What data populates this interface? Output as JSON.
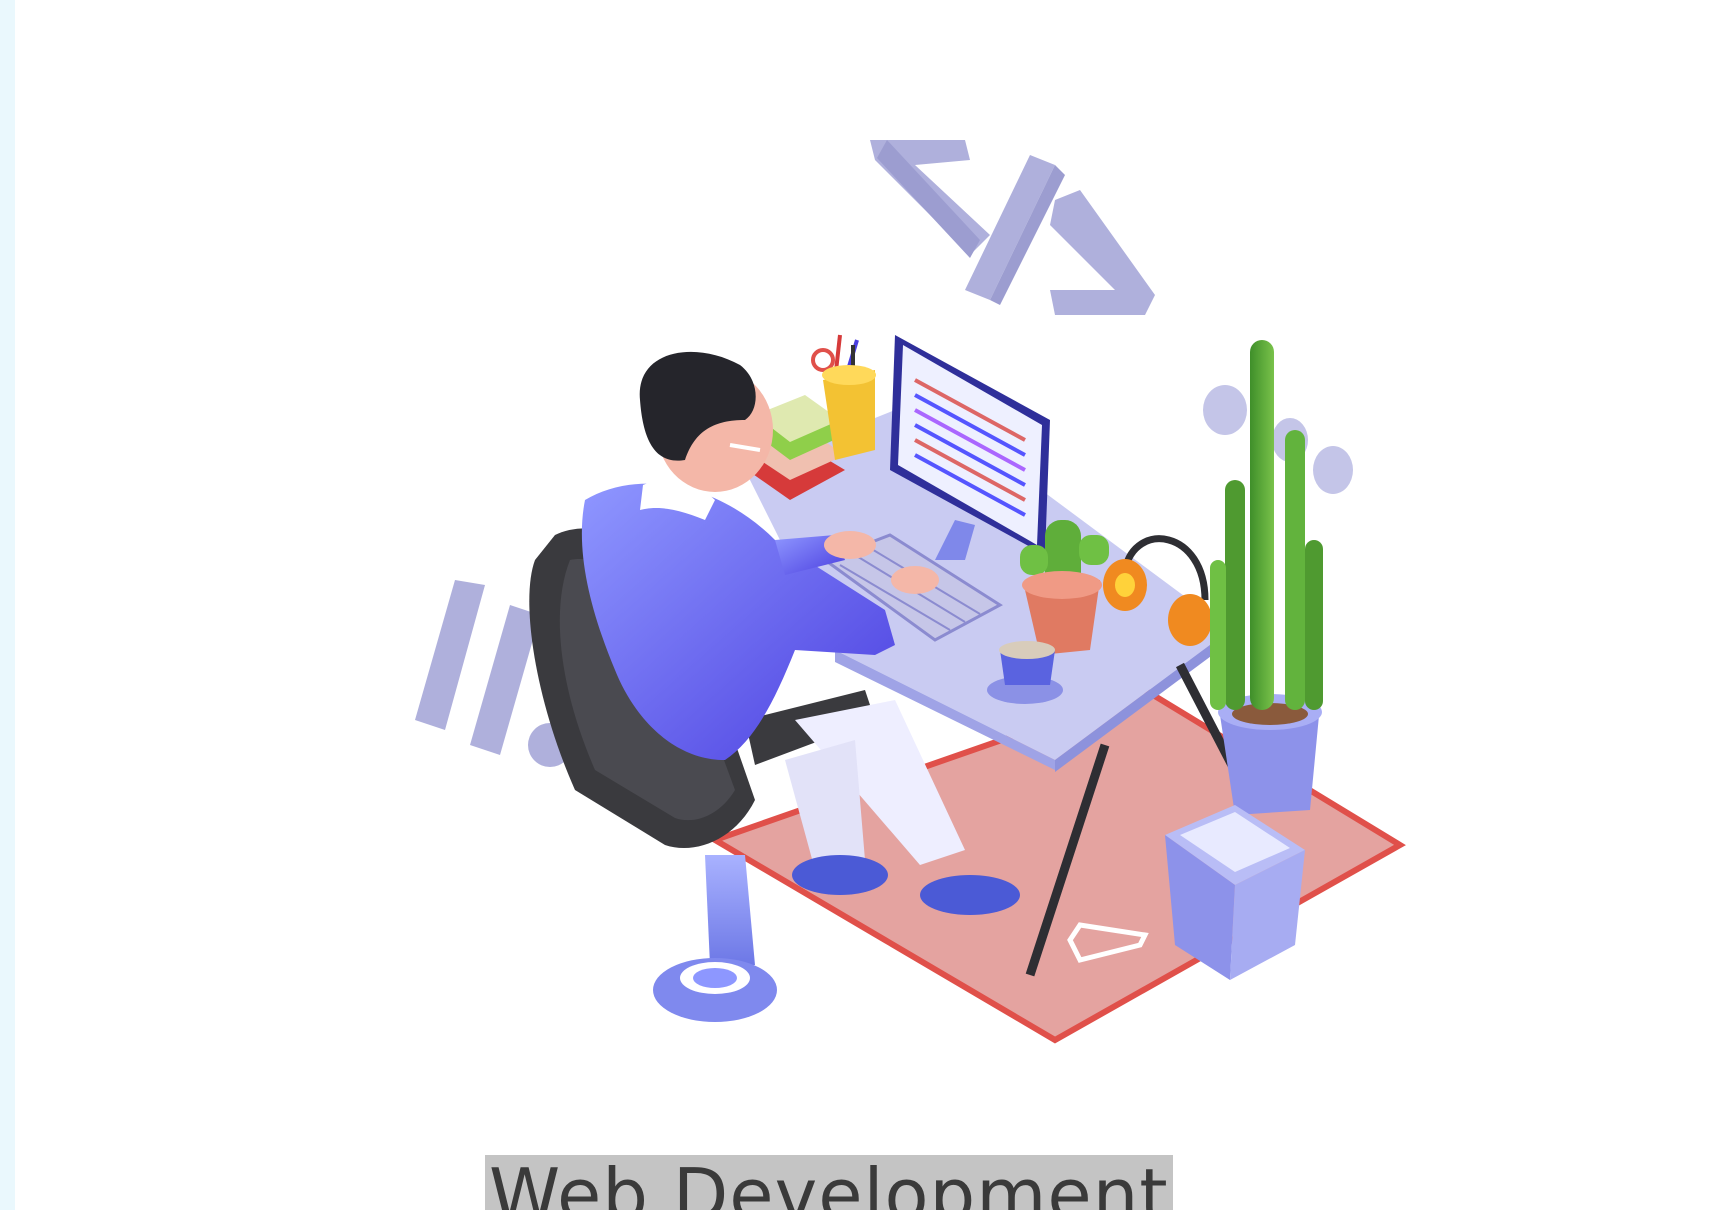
{
  "card": {
    "caption": "Web Development",
    "illustration_icon": "developer-at-desk-illustration"
  },
  "colors": {
    "accent_lavender": "#afb0dc",
    "rug_red": "#e4a3a0",
    "rug_border": "#e0504a",
    "sweater_blue": "#6b72f2",
    "chair_dark": "#3a3a3e",
    "plant_green": "#5fae3a",
    "selection_gray": "#c4c4c4"
  }
}
